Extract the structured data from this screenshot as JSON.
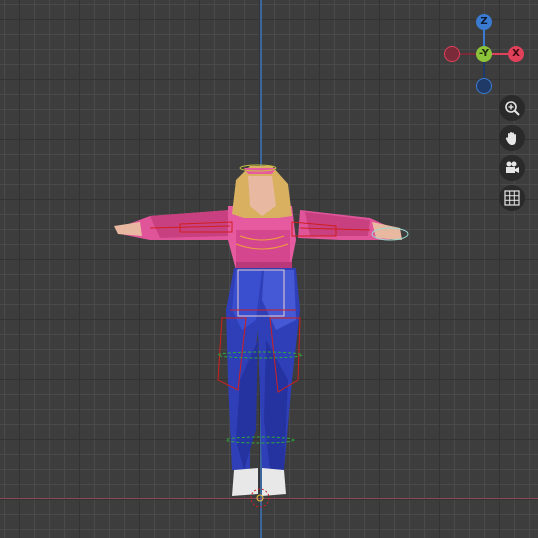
{
  "viewport": {
    "background_color": "#3d3d3d",
    "grid_color": "#4a4a4a",
    "z_axis_color": "#3b6aa8",
    "x_axis_color": "#8a4a5a"
  },
  "gizmo": {
    "z_label": "Z",
    "y_label": "-Y",
    "x_label": "X",
    "z_color": "#3a7ad0",
    "y_color": "#8bc43a",
    "x_color": "#e0405a"
  },
  "nav_buttons": [
    {
      "name": "zoom-button",
      "icon": "zoom-in-icon"
    },
    {
      "name": "pan-button",
      "icon": "hand-icon"
    },
    {
      "name": "camera-view-button",
      "icon": "camera-icon"
    },
    {
      "name": "grid-toggle-button",
      "icon": "grid-icon"
    }
  ],
  "character": {
    "shirt_color": "#e0559a",
    "pants_color": "#2f3fb8",
    "hair_color": "#d8b060",
    "skin_color": "#e8b9a0",
    "shoe_color": "#e8e8e8",
    "armature_color": "#d01f1f",
    "bone_highlight_color": "#2faa3a"
  }
}
